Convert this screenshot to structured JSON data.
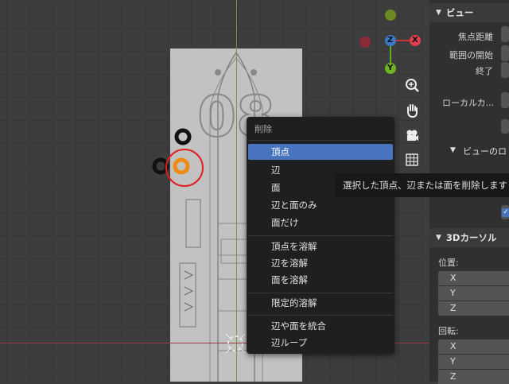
{
  "gizmo": {
    "z_label": "Z",
    "x_label": "X",
    "y_label": "Y"
  },
  "reference_image": {
    "number_text": "08"
  },
  "npanel": {
    "view": {
      "header": "ビュー",
      "focal_length": "焦点距離",
      "clip_start": "範囲の開始",
      "clip_end": "終了",
      "local_camera": "ローカルカ...",
      "view_lock": "ビューのロ"
    },
    "cursor_3d": {
      "header": "3Dカーソル",
      "location_label": "位置:",
      "location_axes": [
        "X",
        "Y",
        "Z"
      ],
      "rotation_label": "回転:",
      "rotation_axes": [
        "X",
        "Y",
        "Z"
      ]
    }
  },
  "context_menu": {
    "title": "削除",
    "items": [
      "頂点",
      "辺",
      "面",
      "辺と面のみ",
      "面だけ",
      "頂点を溶解",
      "辺を溶解",
      "面を溶解",
      "限定的溶解",
      "辺や面を統合",
      "辺ループ"
    ],
    "active_item": "頂点"
  },
  "tooltip": {
    "text": "選択した頂点、辺または面を削除します"
  },
  "colors": {
    "menu_highlight": "#4873bf",
    "selection_orange": "#f08a12",
    "annotation_red": "#e02020"
  },
  "icons": [
    "zoom-icon",
    "hand-pan-icon",
    "camera-icon",
    "grid-icon",
    "checkbox-checked-icon",
    "3d-cursor-icon"
  ]
}
